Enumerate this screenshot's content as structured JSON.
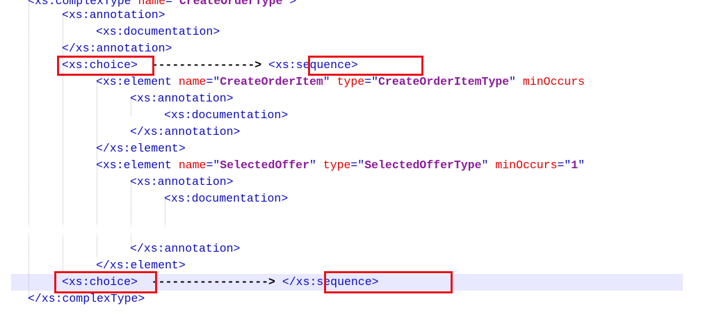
{
  "lines": [
    {
      "parts": [
        {
          "t": "<xs:complexType ",
          "c": "tag"
        },
        {
          "t": "name",
          "c": "attr"
        },
        {
          "t": "=\"",
          "c": "tag"
        },
        {
          "t": "CreateOrderType",
          "c": "val"
        },
        {
          "t": "\">",
          "c": "tag"
        }
      ]
    },
    {
      "parts": [
        {
          "t": "<xs:annotation>",
          "c": "tag"
        }
      ]
    },
    {
      "parts": [
        {
          "t": "<xs:documentation>",
          "c": "tag"
        }
      ]
    },
    {
      "parts": [
        {
          "t": "</xs:annotation>",
          "c": "tag"
        }
      ]
    },
    {
      "parts": [
        {
          "t": "<xs:choice>",
          "c": "tag"
        },
        {
          "t": "  --------------->",
          "c": "arrow"
        },
        {
          "t": " <xs:sequence>",
          "c": "tag"
        }
      ]
    },
    {
      "parts": [
        {
          "t": "<xs:element ",
          "c": "tag"
        },
        {
          "t": "name",
          "c": "attr"
        },
        {
          "t": "=\"",
          "c": "tag"
        },
        {
          "t": "CreateOrderItem",
          "c": "val"
        },
        {
          "t": "\" ",
          "c": "tag"
        },
        {
          "t": "type",
          "c": "attr"
        },
        {
          "t": "=\"",
          "c": "tag"
        },
        {
          "t": "CreateOrderItemType",
          "c": "val"
        },
        {
          "t": "\" ",
          "c": "tag"
        },
        {
          "t": "minOccurs",
          "c": "attr"
        }
      ]
    },
    {
      "parts": [
        {
          "t": "<xs:annotation>",
          "c": "tag"
        }
      ]
    },
    {
      "parts": [
        {
          "t": "<xs:documentation>",
          "c": "tag"
        }
      ]
    },
    {
      "parts": [
        {
          "t": "</xs:annotation>",
          "c": "tag"
        }
      ]
    },
    {
      "parts": [
        {
          "t": "</xs:element>",
          "c": "tag"
        }
      ]
    },
    {
      "parts": [
        {
          "t": "<xs:element ",
          "c": "tag"
        },
        {
          "t": "name",
          "c": "attr"
        },
        {
          "t": "=\"",
          "c": "tag"
        },
        {
          "t": "SelectedOffer",
          "c": "val"
        },
        {
          "t": "\" ",
          "c": "tag"
        },
        {
          "t": "type",
          "c": "attr"
        },
        {
          "t": "=\"",
          "c": "tag"
        },
        {
          "t": "SelectedOfferType",
          "c": "val"
        },
        {
          "t": "\" ",
          "c": "tag"
        },
        {
          "t": "minOccurs",
          "c": "attr"
        },
        {
          "t": "=\"",
          "c": "tag"
        },
        {
          "t": "1",
          "c": "val"
        },
        {
          "t": "\"",
          "c": "tag"
        }
      ]
    },
    {
      "parts": [
        {
          "t": "<xs:annotation>",
          "c": "tag"
        }
      ]
    },
    {
      "parts": [
        {
          "t": "<xs:documentation>",
          "c": "tag"
        }
      ]
    },
    {
      "parts": [
        {
          "t": "</xs:annotation>",
          "c": "tag"
        }
      ]
    },
    {
      "parts": [
        {
          "t": "</xs:element>",
          "c": "tag"
        }
      ]
    },
    {
      "parts": [
        {
          "t": "<xs:choice>",
          "c": "tag"
        },
        {
          "t": "  ----------------->",
          "c": "arrow"
        },
        {
          "t": " </xs:sequence>",
          "c": "tag"
        }
      ]
    },
    {
      "parts": [
        {
          "t": "</xs:complexType>",
          "c": "tag"
        }
      ]
    }
  ],
  "colors": {
    "tag": "#0b0bc0",
    "attr": "#e00000",
    "value": "#8b1c9c",
    "highlight_box": "#e8141c",
    "current_line": "#e8e8ff"
  }
}
